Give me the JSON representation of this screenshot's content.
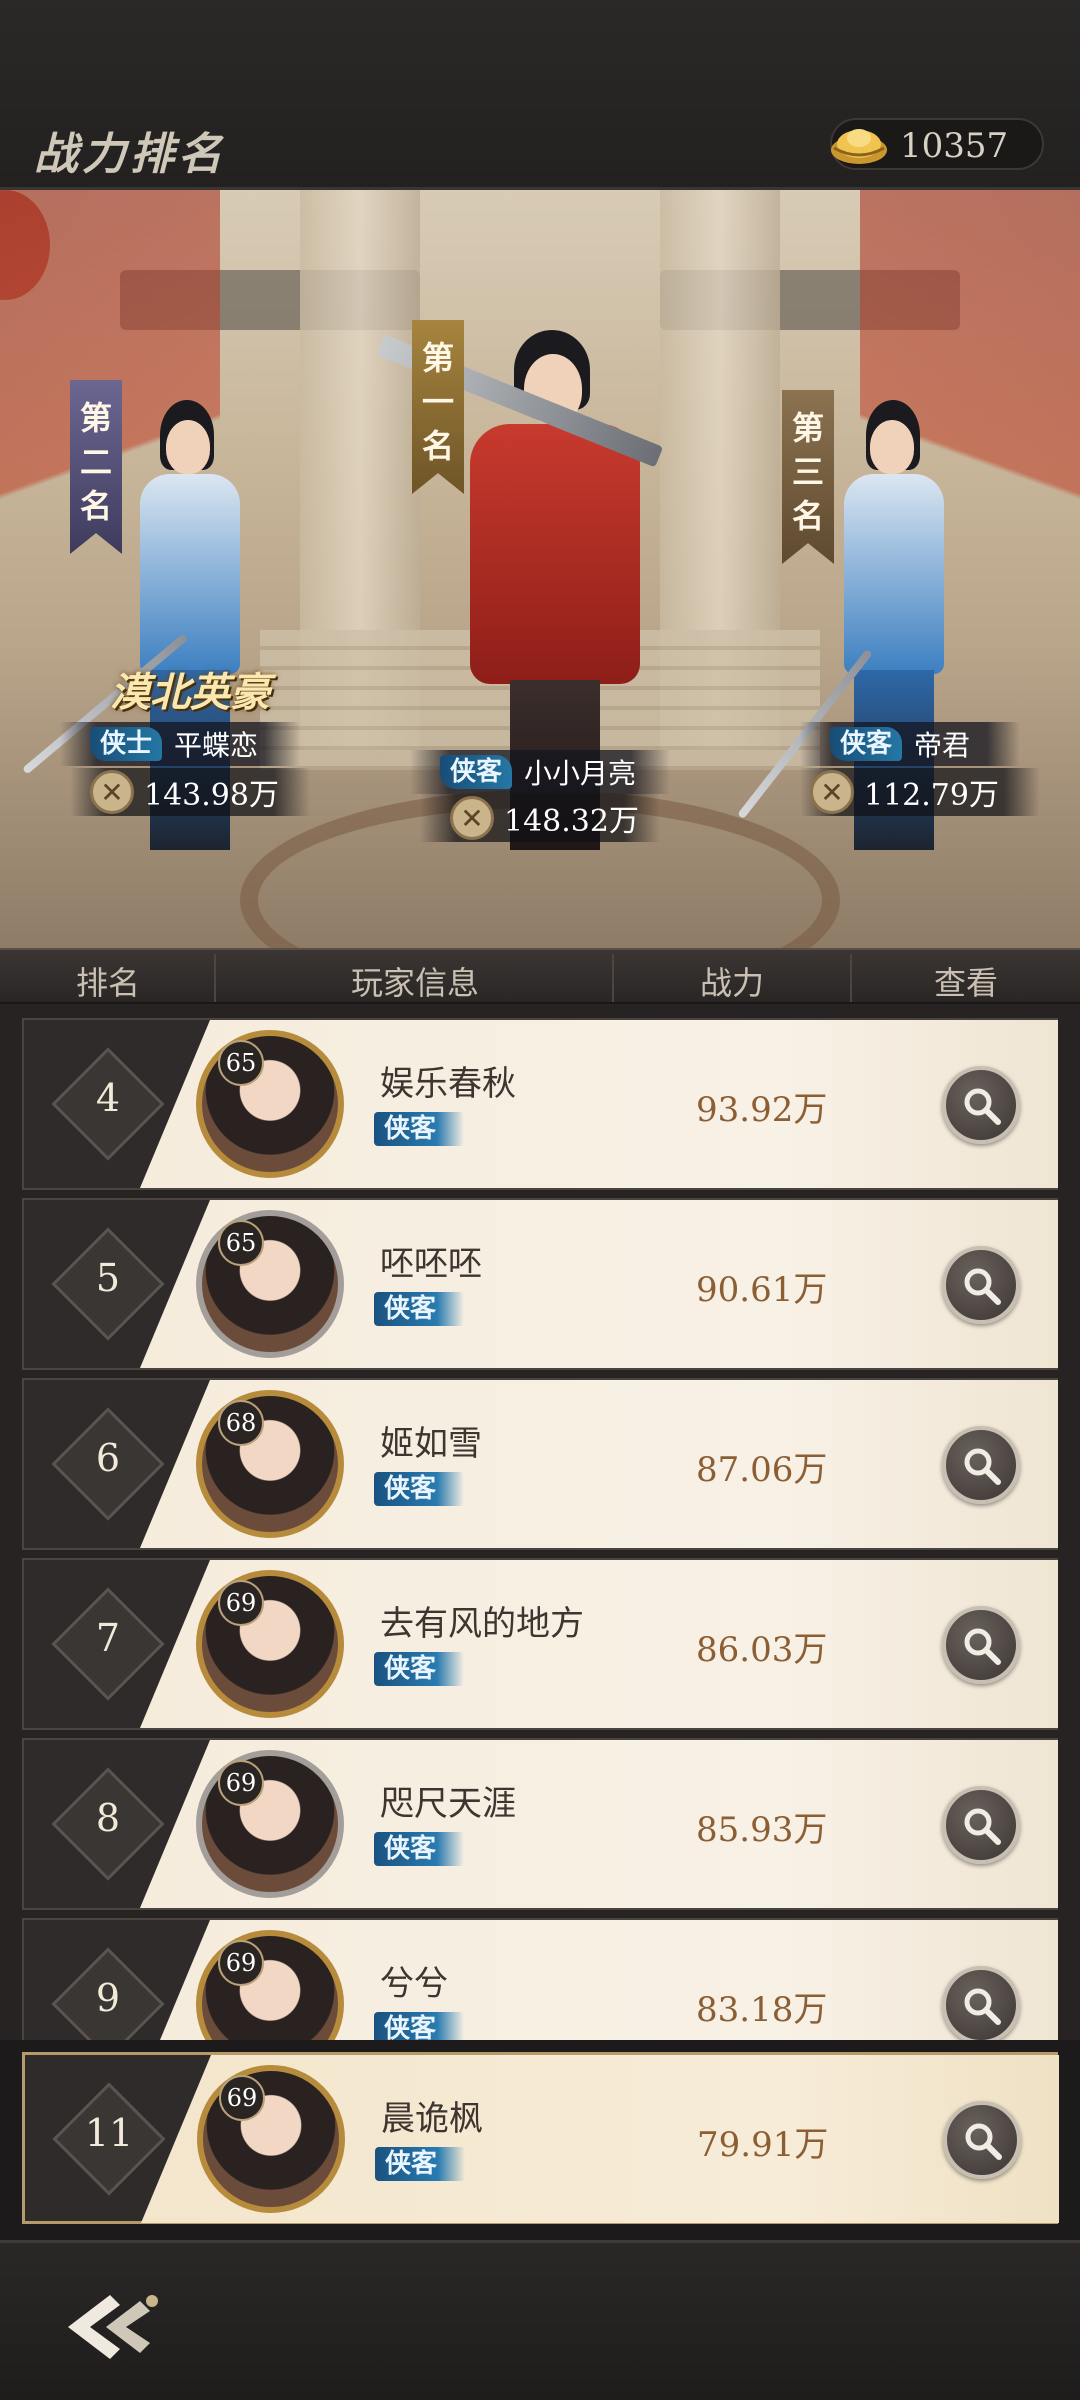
{
  "header": {
    "title": "战力排名",
    "currency_value": "10357",
    "currency_icon": "gold-ingot-icon"
  },
  "podium": {
    "first": {
      "rank_label": "第一名",
      "class": "侠客",
      "name": "小小月亮",
      "power": "148.32万"
    },
    "second": {
      "rank_label": "第二名",
      "class": "侠士",
      "name": "平蝶恋",
      "power": "143.98万",
      "title_badge": "漠北英豪"
    },
    "third": {
      "rank_label": "第三名",
      "class": "侠客",
      "name": "帝君",
      "power": "112.79万"
    }
  },
  "table_headers": {
    "rank": "排名",
    "player_info": "玩家信息",
    "power": "战力",
    "view": "查看"
  },
  "rows": [
    {
      "rank": "4",
      "level": "65",
      "name": "娱乐春秋",
      "class": "侠客",
      "power": "93.92万"
    },
    {
      "rank": "5",
      "level": "65",
      "name": "呸呸呸",
      "class": "侠客",
      "power": "90.61万"
    },
    {
      "rank": "6",
      "level": "68",
      "name": "姬如雪",
      "class": "侠客",
      "power": "87.06万"
    },
    {
      "rank": "7",
      "level": "69",
      "name": "去有风的地方",
      "class": "侠客",
      "power": "86.03万"
    },
    {
      "rank": "8",
      "level": "69",
      "name": "咫尺天涯",
      "class": "侠客",
      "power": "85.93万"
    },
    {
      "rank": "9",
      "level": "69",
      "name": "兮兮",
      "class": "侠客",
      "power": "83.18万"
    }
  ],
  "my_rank": {
    "rank": "11",
    "level": "69",
    "name": "晨诡枫",
    "class": "侠客",
    "power": "79.91万"
  },
  "colors": {
    "accent_gold": "#b78b3c",
    "class_tag_blue": "#2577a5",
    "power_text": "#8b5e34"
  }
}
